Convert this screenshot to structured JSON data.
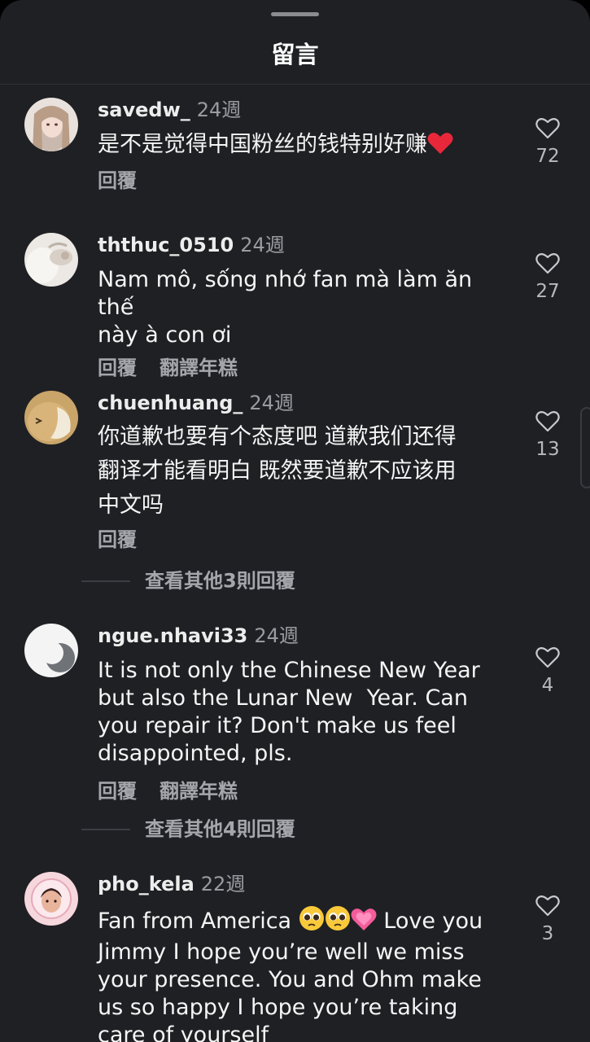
{
  "sheet": {
    "title": "留言"
  },
  "comments": [
    {
      "username": "savedw_",
      "time": "24週",
      "text": "是不是觉得中国粉丝的钱特别好赚",
      "text_suffix_emoji": "red-heart",
      "reply_label": "回覆",
      "translate_label": "",
      "likes": "72"
    },
    {
      "username": "ththuc_0510",
      "time": "24週",
      "text": "Nam mô, sống nhớ fan mà làm ăn thế\nnày à con ơi",
      "reply_label": "回覆",
      "translate_label": "翻譯年糕",
      "likes": "27"
    },
    {
      "username": "chuenhuang_",
      "time": "24週",
      "text": "你道歉也要有个态度吧 道歉我们还得\n翻译才能看明白 既然要道歉不应该用\n中文吗",
      "reply_label": "回覆",
      "translate_label": "",
      "likes": "13",
      "view_more": "查看其他3則回覆"
    },
    {
      "username": "ngue.nhavi33",
      "time": "24週",
      "text": "It is not only the Chinese New Year\nbut also the Lunar New  Year. Can\nyou repair it? Don't make us feel\ndisappointed, pls.",
      "reply_label": "回覆",
      "translate_label": "翻譯年糕",
      "likes": "4",
      "view_more": "查看其他4則回覆"
    },
    {
      "username": "pho_kela",
      "time": "22週",
      "text_prefix": "Fan from America ",
      "text_emojis": [
        "pleading-face",
        "pleading-face",
        "growing-heart"
      ],
      "text_rest": " Love you\nJimmy I hope you’re well we miss\nyour presence. You and Ohm make\nus so happy I hope you’re taking\ncare of yourself",
      "likes": "3"
    }
  ],
  "colors": {
    "background": "#1f2024",
    "text": "#f5f5f5",
    "muted": "#9a9ba0",
    "heart_emoji": "#e8283a"
  }
}
